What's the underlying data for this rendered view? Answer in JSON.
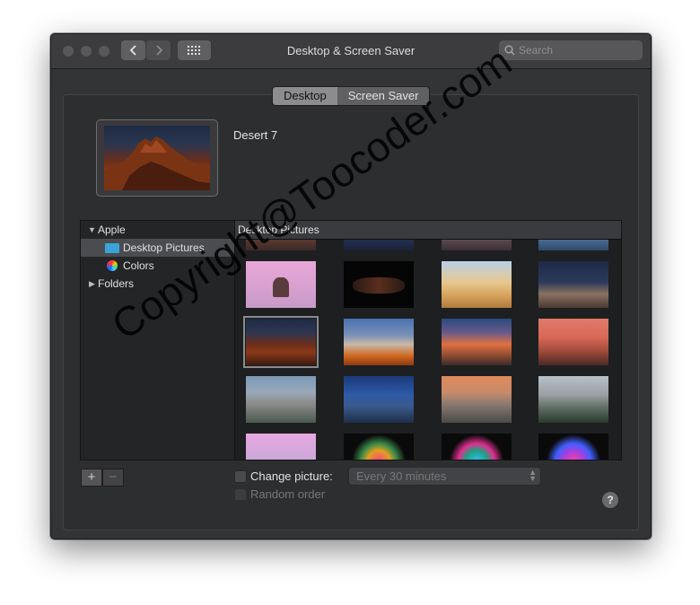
{
  "window": {
    "title": "Desktop & Screen Saver",
    "search_placeholder": "Search"
  },
  "tabs": [
    {
      "label": "Desktop",
      "active": true
    },
    {
      "label": "Screen Saver",
      "active": false
    }
  ],
  "preview": {
    "name": "Desert 7"
  },
  "sidebar": {
    "groups": [
      {
        "label": "Apple",
        "expanded": true,
        "items": [
          {
            "label": "Desktop Pictures",
            "icon": "folder-icon",
            "selected": true
          },
          {
            "label": "Colors",
            "icon": "color-wheel-icon",
            "selected": false
          }
        ]
      },
      {
        "label": "Folders",
        "expanded": false,
        "items": []
      }
    ]
  },
  "content": {
    "header": "Desktop Pictures"
  },
  "bottom": {
    "add_label": "+",
    "remove_label": "−",
    "change_picture_label": "Change picture:",
    "change_picture_checked": false,
    "interval_value": "Every 30 minutes",
    "random_order_label": "Random order",
    "random_order_checked": false,
    "help_label": "?"
  },
  "watermark": "Copyright@Toocoder.com",
  "colors": {
    "window_bg": "#333436",
    "panel_bg": "#2d2e30",
    "selected_tab": "#8c8c8e",
    "folder_icon": "#3aa3d8"
  }
}
